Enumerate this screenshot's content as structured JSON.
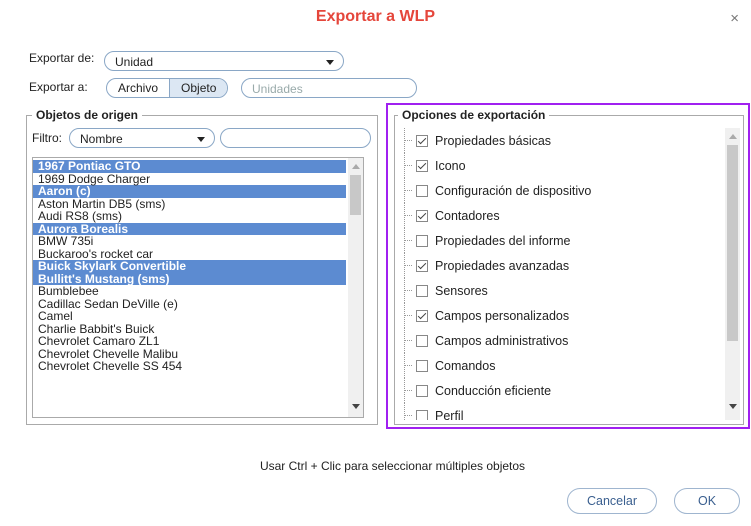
{
  "dialog": {
    "title": "Exportar a WLP",
    "close": "×"
  },
  "export_from": {
    "label": "Exportar de:",
    "value": "Unidad"
  },
  "export_to": {
    "label": "Exportar a:",
    "options": [
      "Archivo",
      "Objeto"
    ],
    "selected": "Objeto",
    "target_placeholder": "Unidades"
  },
  "source": {
    "legend": "Objetos de origen",
    "filter_label": "Filtro:",
    "filter_value": "Nombre",
    "filter_text": "",
    "items": [
      {
        "label": "1967 Pontiac GTO",
        "selected": true
      },
      {
        "label": "1969 Dodge Charger",
        "selected": false
      },
      {
        "label": "Aaron (c)",
        "selected": true
      },
      {
        "label": "Aston Martin DB5 (sms)",
        "selected": false
      },
      {
        "label": "Audi RS8 (sms)",
        "selected": false
      },
      {
        "label": "Aurora Borealis",
        "selected": true
      },
      {
        "label": "BMW 735i",
        "selected": false
      },
      {
        "label": "Buckaroo's rocket car",
        "selected": false
      },
      {
        "label": "Buick Skylark Convertible",
        "selected": true
      },
      {
        "label": "Bullitt's Mustang (sms)",
        "selected": true
      },
      {
        "label": "Bumblebee",
        "selected": false
      },
      {
        "label": "Cadillac Sedan DeVille (e)",
        "selected": false
      },
      {
        "label": "Camel",
        "selected": false
      },
      {
        "label": "Charlie Babbit's Buick",
        "selected": false
      },
      {
        "label": "Chevrolet Camaro ZL1",
        "selected": false
      },
      {
        "label": "Chevrolet Chevelle Malibu",
        "selected": false
      },
      {
        "label": "Chevrolet Chevelle SS 454",
        "selected": false
      }
    ]
  },
  "options": {
    "legend": "Opciones de exportación",
    "items": [
      {
        "label": "Propiedades básicas",
        "checked": true
      },
      {
        "label": "Icono",
        "checked": true
      },
      {
        "label": "Configuración de dispositivo",
        "checked": false
      },
      {
        "label": "Contadores",
        "checked": true
      },
      {
        "label": "Propiedades del informe",
        "checked": false
      },
      {
        "label": "Propiedades avanzadas",
        "checked": true
      },
      {
        "label": "Sensores",
        "checked": false
      },
      {
        "label": "Campos personalizados",
        "checked": true
      },
      {
        "label": "Campos administrativos",
        "checked": false
      },
      {
        "label": "Comandos",
        "checked": false
      },
      {
        "label": "Conducción eficiente",
        "checked": false
      },
      {
        "label": "Perfil",
        "checked": false
      }
    ],
    "highlight_color": "#a020f0"
  },
  "hint": "Usar Ctrl + Clic para seleccionar múltiples objetos",
  "buttons": {
    "cancel": "Cancelar",
    "ok": "OK"
  }
}
